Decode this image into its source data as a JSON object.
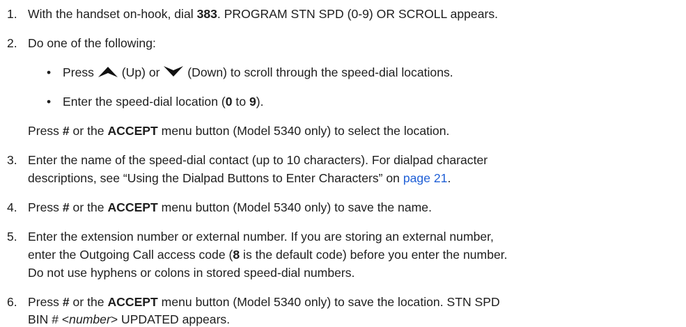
{
  "steps": [
    {
      "number": "1.",
      "line1": {
        "a": "With the handset on-hook, dial ",
        "b": "383",
        "c": ". PROGRAM STN SPD (0-9) OR SCROLL appears."
      }
    },
    {
      "number": "2.",
      "line1": "Do one of the following:",
      "bullets": [
        {
          "a": "Press ",
          "up": " (Up) or ",
          "down": " (Down) to scroll through the speed-dial locations."
        },
        {
          "a": "Enter the speed-dial location (",
          "b": "0",
          "c": " to ",
          "d": "9",
          "e": ")."
        }
      ],
      "after": {
        "a": "Press ",
        "b": "#",
        "c": " or the ",
        "d": "ACCEPT",
        "e": " menu button (Model 5340 only) to select the location."
      }
    },
    {
      "number": "3.",
      "line1": "Enter the name of the speed-dial contact (up to 10 characters). For dialpad character",
      "line2": {
        "a": "descriptions, see “Using the Dialpad Buttons to Enter Characters” on ",
        "link": "page 21",
        "c": "."
      }
    },
    {
      "number": "4.",
      "line1": {
        "a": "Press ",
        "b": "#",
        "c": " or the ",
        "d": "ACCEPT",
        "e": " menu button (Model 5340 only) to save the name."
      }
    },
    {
      "number": "5.",
      "line1": "Enter the extension number or external number. If you are storing an external number,",
      "line2": {
        "a": "enter the Outgoing Call access code (",
        "b": "8",
        "c": " is the default code) before you enter the number."
      },
      "line3": "Do not use hyphens or colons in stored speed-dial numbers."
    },
    {
      "number": "6.",
      "line1": {
        "a": "Press ",
        "b": "#",
        "c": " or the ",
        "d": "ACCEPT",
        "e": " menu button (Model 5340 only) to save the location. STN SPD"
      },
      "line2": {
        "a": "BIN # <",
        "b": "number",
        "c": "> UPDATED appears."
      }
    }
  ],
  "bullet_char": "•",
  "icons": {
    "up": "up-arrow-icon",
    "down": "down-arrow-icon"
  },
  "colors": {
    "text": "#1e1e1e",
    "link": "#1f5fd6"
  }
}
